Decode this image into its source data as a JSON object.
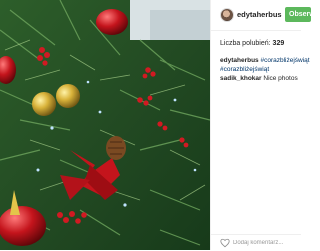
{
  "post": {
    "username": "edytaherbus",
    "follow_label": "Obserwuj",
    "likes_label": "Liczba polubień:",
    "likes_count": "329",
    "caption_user": "edytaherbus",
    "caption_tags": [
      "#corazbliżejświąt",
      "#corazbliżejświąt"
    ],
    "comment_user": "sadik_khokar",
    "comment_text": "Nice photos",
    "comment_placeholder": "Dodaj komentarz..."
  },
  "photo": {
    "subject": "christmas tree with red and gold ornaments",
    "colors": {
      "needles": "#2f6b2b",
      "dark_needles": "#17361a",
      "red": "#c4141c",
      "gold": "#c9a22a"
    }
  }
}
